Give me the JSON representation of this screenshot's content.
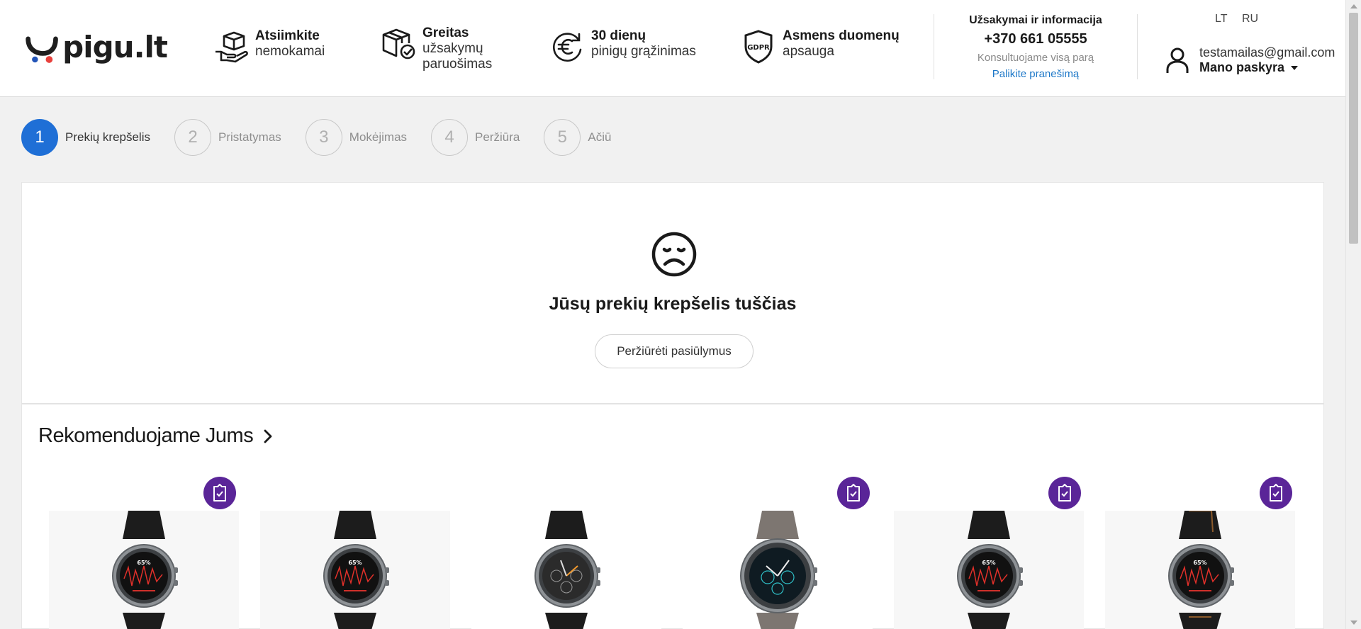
{
  "brand": {
    "logo_text": "pigu.lt"
  },
  "features": [
    {
      "icon": "hand-package-icon",
      "title": "Atsiimkite",
      "subtitle": "nemokamai"
    },
    {
      "icon": "box-check-icon",
      "title": "Greitas",
      "subtitle": "užsakymų paruošimas"
    },
    {
      "icon": "euro-refund-icon",
      "title": "30 dienų",
      "subtitle": "pinigų grąžinimas"
    },
    {
      "icon": "gdpr-shield-icon",
      "title": "Asmens duomenų",
      "subtitle": "apsauga"
    }
  ],
  "contact": {
    "title": "Užsakymai ir informacija",
    "phone": "+370 661 05555",
    "subtitle": "Konsultuojame visą parą",
    "link": "Palikite pranešimą"
  },
  "languages": [
    "LT",
    "RU"
  ],
  "account": {
    "email": "testamailas@gmail.com",
    "label": "Mano paskyra"
  },
  "steps": [
    {
      "number": "1",
      "label": "Prekių krepšelis",
      "active": true
    },
    {
      "number": "2",
      "label": "Pristatymas",
      "active": false
    },
    {
      "number": "3",
      "label": "Mokėjimas",
      "active": false
    },
    {
      "number": "4",
      "label": "Peržiūra",
      "active": false
    },
    {
      "number": "5",
      "label": "Ačiū",
      "active": false
    }
  ],
  "cart": {
    "empty_title": "Jūsų prekių krepšelis tuščias",
    "button_label": "Peržiūrėti pasiūlymus"
  },
  "recommendations": {
    "title": "Rekomenduojame Jums",
    "products": [
      {
        "name": "product-watch-1",
        "badge": true,
        "strap": "black",
        "face": "red-chart",
        "display": "65%"
      },
      {
        "name": "product-watch-2",
        "badge": false,
        "strap": "black",
        "face": "red-chart",
        "display": "65%"
      },
      {
        "name": "product-watch-3",
        "badge": false,
        "strap": "black-rubber",
        "face": "chronograph",
        "display": ""
      },
      {
        "name": "product-watch-4",
        "badge": true,
        "strap": "grey-leather",
        "face": "teal-chronograph",
        "display": ""
      },
      {
        "name": "product-watch-5",
        "badge": true,
        "strap": "black",
        "face": "red-chart",
        "display": "65%"
      },
      {
        "name": "product-watch-6",
        "badge": true,
        "strap": "black-leather",
        "face": "red-chart",
        "display": "65%"
      }
    ]
  },
  "colors": {
    "accent_blue": "#1f6fd6",
    "badge_purple": "#5a2598",
    "logo_blue": "#2355b8",
    "logo_red": "#e8413d",
    "link_blue": "#1e78c8"
  }
}
